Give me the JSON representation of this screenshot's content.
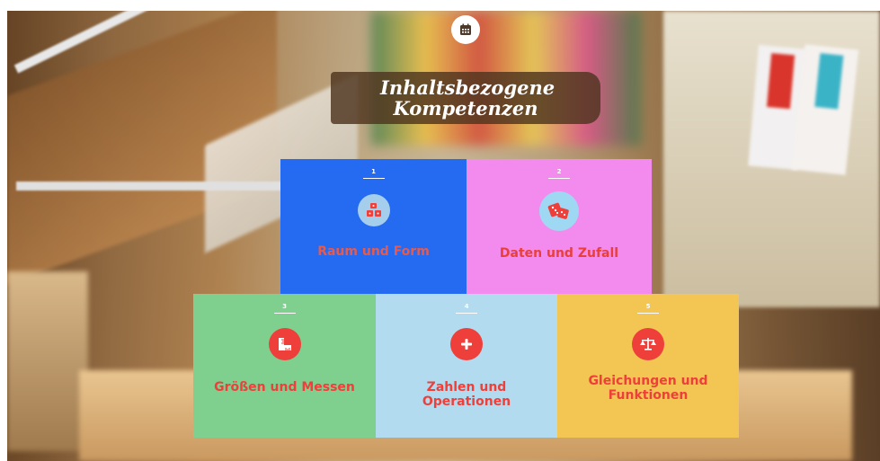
{
  "header": {
    "icon": "calendar-icon",
    "title": "Inhaltsbezogene Kompetenzen"
  },
  "tiles": [
    {
      "number": "1",
      "label": "Raum und Form",
      "icon": "cubes-icon",
      "color": "#246bf2"
    },
    {
      "number": "2",
      "label": "Daten und Zufall",
      "icon": "dice-icon",
      "color": "#f38bee"
    },
    {
      "number": "3",
      "label": "Größen und Messen",
      "icon": "ruler-icon",
      "color": "#7fcf8f"
    },
    {
      "number": "4",
      "label": "Zahlen und Operationen",
      "icon": "plus-icon",
      "color": "#b3dbef"
    },
    {
      "number": "5",
      "label": "Gleichungen und Funktionen",
      "icon": "scale-icon",
      "color": "#f3c553"
    }
  ],
  "colors": {
    "accent": "#ef3f3a",
    "title_box": "#4e341e"
  }
}
